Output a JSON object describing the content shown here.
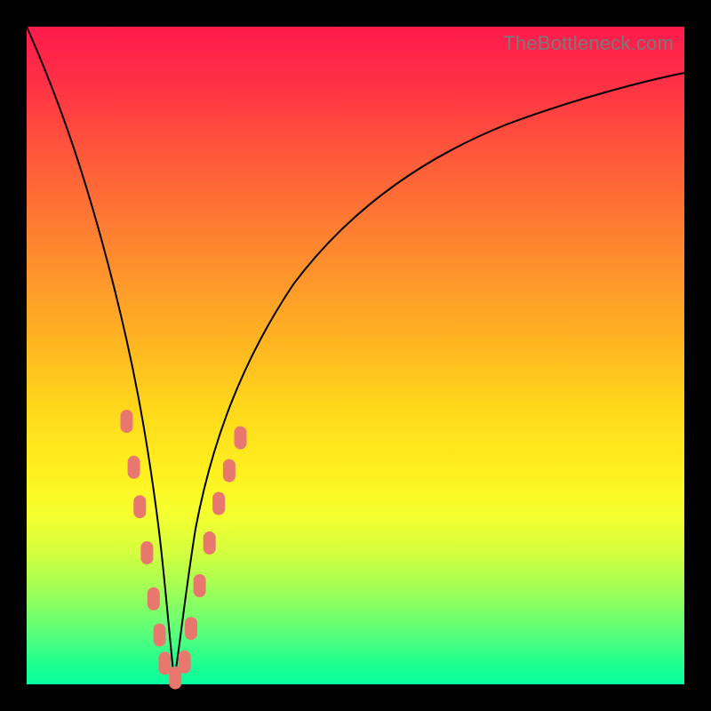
{
  "watermark": "TheBottleneck.com",
  "colors": {
    "frame": "#000000",
    "watermark": "#7a7a7a",
    "curve": "#000000",
    "marker": "#e8786d"
  },
  "chart_data": {
    "type": "line",
    "title": "",
    "xlabel": "",
    "ylabel": "",
    "xlim": [
      0,
      100
    ],
    "ylim": [
      0,
      100
    ],
    "grid": false,
    "legend": false,
    "description": "V-shaped bottleneck curve over vertical rainbow gradient (red=high bottleneck at top, green=low at bottom). Minimum near x≈22.",
    "series": [
      {
        "name": "bottleneck-curve",
        "x": [
          0,
          4,
          8,
          12,
          15,
          18,
          20,
          22,
          24,
          26,
          30,
          36,
          44,
          54,
          66,
          80,
          100
        ],
        "y": [
          100,
          86,
          71,
          55,
          41,
          24,
          10,
          1,
          8,
          18,
          32,
          46,
          58,
          68,
          76,
          82,
          87.5
        ]
      }
    ],
    "markers": {
      "name": "highlight-points",
      "shape": "rounded-rect",
      "color": "#e8786d",
      "points": [
        {
          "x": 15.2,
          "y": 40
        },
        {
          "x": 16.3,
          "y": 33
        },
        {
          "x": 17.2,
          "y": 27
        },
        {
          "x": 18.3,
          "y": 20
        },
        {
          "x": 19.3,
          "y": 13
        },
        {
          "x": 20.2,
          "y": 7.5
        },
        {
          "x": 21.0,
          "y": 3.2
        },
        {
          "x": 22.6,
          "y": 1.0
        },
        {
          "x": 24.0,
          "y": 3.4
        },
        {
          "x": 25.0,
          "y": 8.5
        },
        {
          "x": 26.3,
          "y": 15
        },
        {
          "x": 27.8,
          "y": 21.5
        },
        {
          "x": 29.2,
          "y": 27.5
        },
        {
          "x": 30.8,
          "y": 32.5
        },
        {
          "x": 32.5,
          "y": 37.5
        }
      ]
    }
  }
}
